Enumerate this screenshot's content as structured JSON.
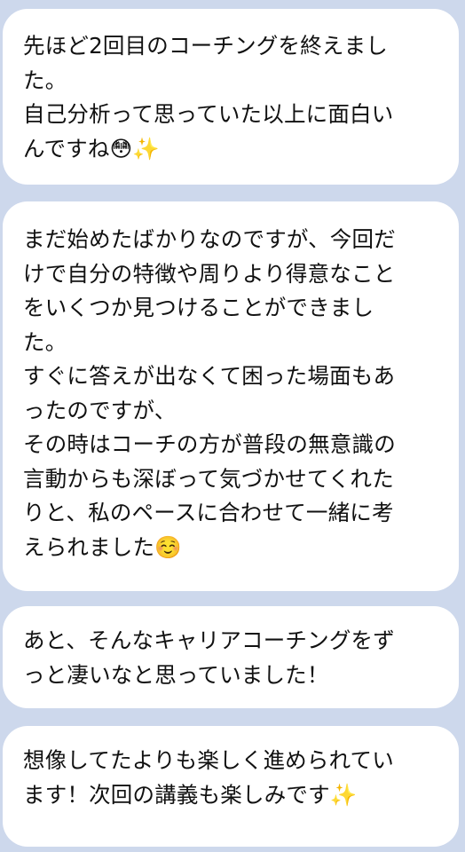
{
  "messages": [
    {
      "lines": [
        "先ほど2回目のコーチングを終えまし",
        "た。",
        "自己分析って思っていた以上に面白い",
        "んですね😳✨"
      ]
    },
    {
      "lines": [
        "まだ始めたばかりなのですが、今回だ",
        "けで自分の特徴や周りより得意なこと",
        "をいくつか見つけることができまし",
        "た。",
        "すぐに答えが出なくて困った場面もあ",
        "ったのですが、",
        "その時はコーチの方が普段の無意識の",
        "言動からも深ぼって気づかせてくれた",
        "りと、私のペースに合わせて一緒に考",
        "えられました☺️"
      ]
    },
    {
      "lines": [
        "あと、そんなキャリアコーチングをず",
        "っと凄いなと思っていました！"
      ]
    },
    {
      "lines": [
        "想像してたよりも楽しく進められてい",
        "ます！次回の講義も楽しみです✨"
      ]
    }
  ]
}
